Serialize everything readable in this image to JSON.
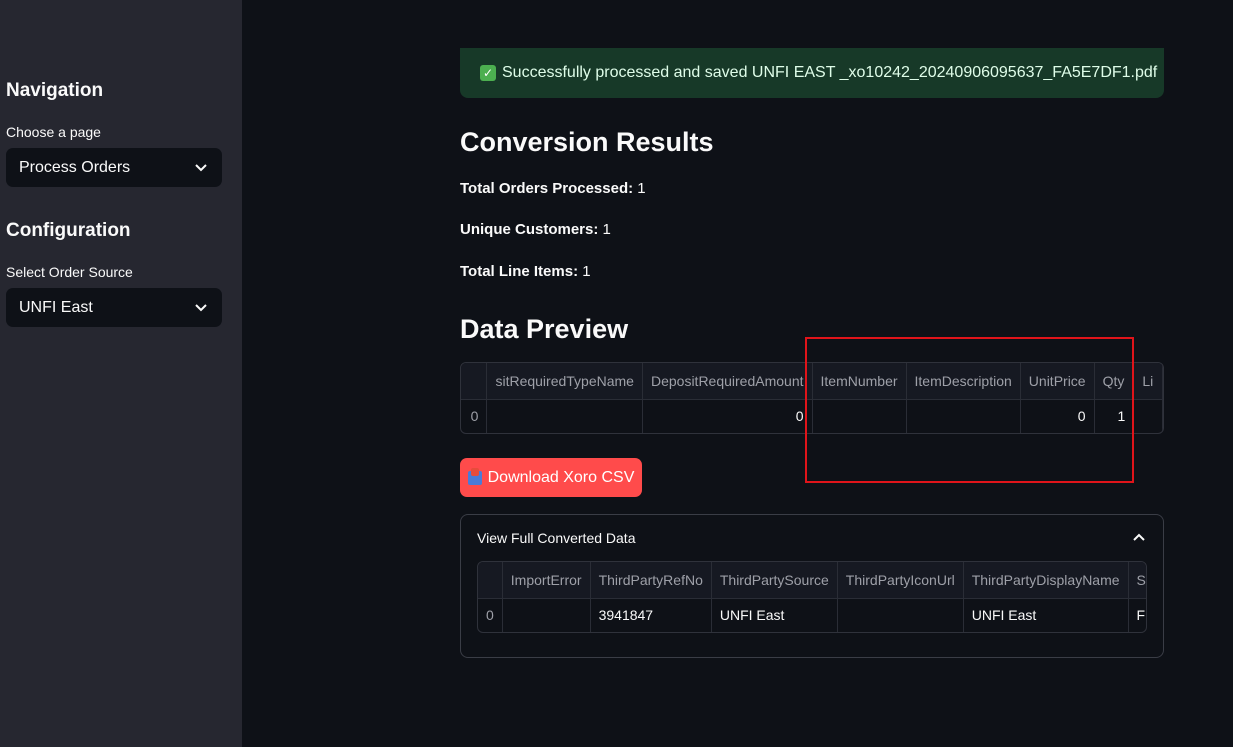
{
  "sidebar": {
    "nav_heading": "Navigation",
    "page_label": "Choose a page",
    "page_value": "Process Orders",
    "config_heading": "Configuration",
    "source_label": "Select Order Source",
    "source_value": "UNFI East"
  },
  "alert": {
    "icon": "check-icon",
    "message": "Successfully processed and saved UNFI EAST _xo10242_20240906095637_FA5E7DF1.pdf"
  },
  "results": {
    "title": "Conversion Results",
    "stats": [
      {
        "label": "Total Orders Processed:",
        "value": "1"
      },
      {
        "label": "Unique Customers:",
        "value": "1"
      },
      {
        "label": "Total Line Items:",
        "value": "1"
      }
    ]
  },
  "preview": {
    "title": "Data Preview",
    "columns": [
      "",
      "sitRequiredTypeName",
      "DepositRequiredAmount",
      "ItemNumber",
      "ItemDescription",
      "UnitPrice",
      "Qty",
      "Li"
    ],
    "row": [
      "0",
      "",
      "0",
      "",
      "",
      "0",
      "1",
      ""
    ]
  },
  "download_button": {
    "label": "Download Xoro CSV",
    "icon": "inbox-tray-icon"
  },
  "expander": {
    "title": "View Full Converted Data",
    "columns": [
      "",
      "ImportError",
      "ThirdPartyRefNo",
      "ThirdPartySource",
      "ThirdPartyIconUrl",
      "ThirdPartyDisplayName",
      "S"
    ],
    "row": [
      "0",
      "",
      "3941847",
      "UNFI East",
      "",
      "UNFI East",
      "F"
    ]
  },
  "colors": {
    "accent": "#ff4b4b",
    "success_bg": "#173928",
    "sidebar_bg": "#262730",
    "annotation": "#e0141a"
  }
}
